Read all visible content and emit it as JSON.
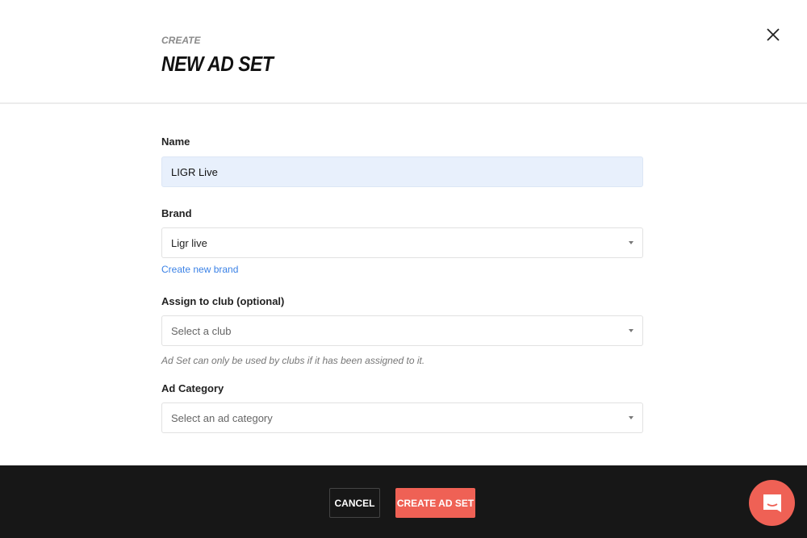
{
  "header": {
    "eyebrow": "CREATE",
    "title": "NEW AD SET"
  },
  "form": {
    "name": {
      "label": "Name",
      "value": "LIGR Live"
    },
    "brand": {
      "label": "Brand",
      "value": "Ligr live",
      "create_link": "Create new brand"
    },
    "club": {
      "label": "Assign to club (optional)",
      "placeholder": "Select a club",
      "hint": "Ad Set can only be used by clubs if it has been assigned to it."
    },
    "category": {
      "label": "Ad Category",
      "placeholder": "Select an ad category"
    }
  },
  "footer": {
    "cancel_label": "CANCEL",
    "create_label": "CREATE AD SET"
  },
  "colors": {
    "accent": "#ef6155",
    "link": "#3b82e6",
    "footer_bg": "#171717",
    "input_filled": "#e8f0fc"
  },
  "icons": {
    "close": "close-icon",
    "chat": "chat-icon",
    "dropdown": "caret-down-icon"
  }
}
